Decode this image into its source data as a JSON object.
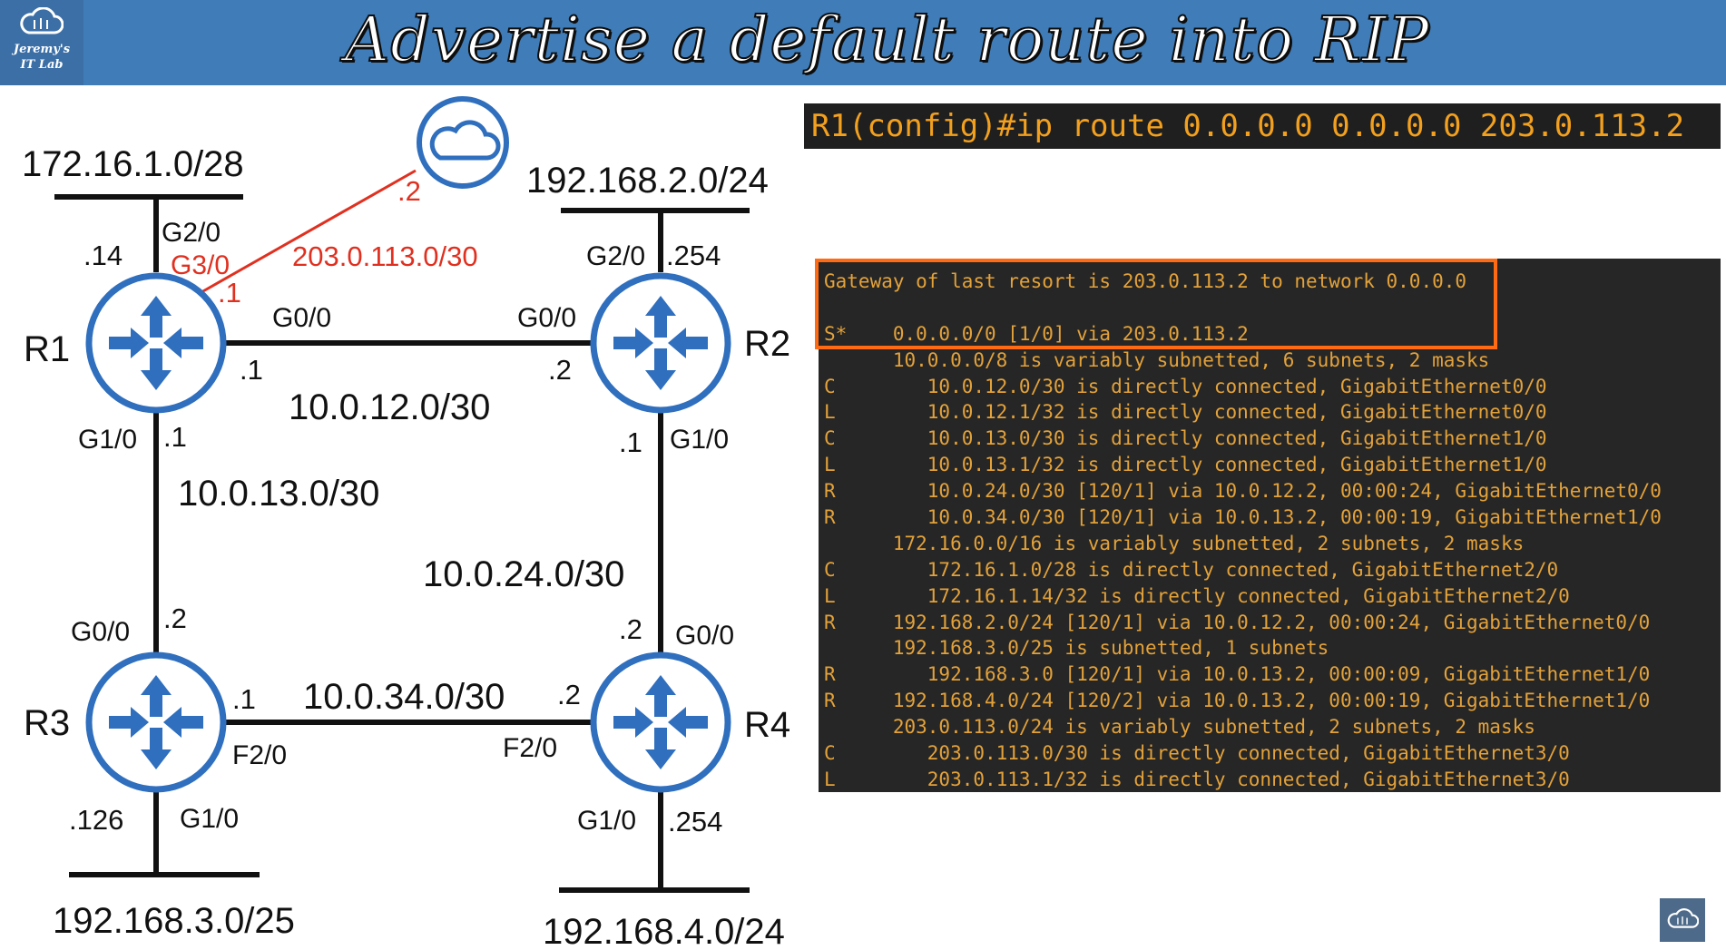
{
  "header": {
    "title": "Advertise a default route into RIP",
    "logo_line1": "Jeremy's",
    "logo_line2": "IT Lab"
  },
  "colors": {
    "header_bg": "#3f7cb8",
    "router_blue": "#2f6fbe",
    "link_red": "#e03020",
    "terminal_text": "#e3a23a",
    "highlight": "#ff6a13"
  },
  "diagram": {
    "routers": [
      {
        "id": "R1",
        "label": "R1"
      },
      {
        "id": "R2",
        "label": "R2"
      },
      {
        "id": "R3",
        "label": "R3"
      },
      {
        "id": "R4",
        "label": "R4"
      }
    ],
    "cloud": {
      "icon": "cloud-icon",
      "ip": ".2"
    },
    "lan_networks": {
      "r1": "172.16.1.0/28",
      "r2": "192.168.2.0/24",
      "r3": "192.168.3.0/25",
      "r4": "192.168.4.0/24"
    },
    "links": {
      "r1_r2": "10.0.12.0/30",
      "r1_r3": "10.0.13.0/30",
      "r2_r4": "10.0.24.0/30",
      "r3_r4": "10.0.34.0/30",
      "r1_internet": "203.0.113.0/30"
    },
    "interfaces": {
      "r1_g20": "G2/0",
      "r1_g20_ip": ".14",
      "r1_g30": "G3/0",
      "r1_g30_ip": ".1",
      "r1_g00": "G0/0",
      "r1_g00_ip": ".1",
      "r1_g10": "G1/0",
      "r1_g10_ip": ".1",
      "r2_g20": "G2/0",
      "r2_g20_ip": ".254",
      "r2_g00": "G0/0",
      "r2_g00_ip": ".2",
      "r2_g10": "G1/0",
      "r2_g10_ip": ".1",
      "r3_g00": "G0/0",
      "r3_g00_ip": ".2",
      "r3_f20": "F2/0",
      "r3_f20_ip": ".1",
      "r3_g10": "G1/0",
      "r3_g10_ip": ".126",
      "r4_g00": "G0/0",
      "r4_g00_ip": ".2",
      "r4_f20": "F2/0",
      "r4_f20_ip": ".2",
      "r4_g10": "G1/0",
      "r4_g10_ip": ".254"
    }
  },
  "command": "R1(config)#ip route 0.0.0.0 0.0.0.0 203.0.113.2",
  "routing_table": [
    "Gateway of last resort is 203.0.113.2 to network 0.0.0.0",
    "",
    "S*    0.0.0.0/0 [1/0] via 203.0.113.2",
    "      10.0.0.0/8 is variably subnetted, 6 subnets, 2 masks",
    "C        10.0.12.0/30 is directly connected, GigabitEthernet0/0",
    "L        10.0.12.1/32 is directly connected, GigabitEthernet0/0",
    "C        10.0.13.0/30 is directly connected, GigabitEthernet1/0",
    "L        10.0.13.1/32 is directly connected, GigabitEthernet1/0",
    "R        10.0.24.0/30 [120/1] via 10.0.12.2, 00:00:24, GigabitEthernet0/0",
    "R        10.0.34.0/30 [120/1] via 10.0.13.2, 00:00:19, GigabitEthernet1/0",
    "      172.16.0.0/16 is variably subnetted, 2 subnets, 2 masks",
    "C        172.16.1.0/28 is directly connected, GigabitEthernet2/0",
    "L        172.16.1.14/32 is directly connected, GigabitEthernet2/0",
    "R     192.168.2.0/24 [120/1] via 10.0.12.2, 00:00:24, GigabitEthernet0/0",
    "      192.168.3.0/25 is subnetted, 1 subnets",
    "R        192.168.3.0 [120/1] via 10.0.13.2, 00:00:09, GigabitEthernet1/0",
    "R     192.168.4.0/24 [120/2] via 10.0.13.2, 00:00:19, GigabitEthernet1/0",
    "      203.0.113.0/24 is variably subnetted, 2 subnets, 2 masks",
    "C        203.0.113.0/30 is directly connected, GigabitEthernet3/0",
    "L        203.0.113.1/32 is directly connected, GigabitEthernet3/0"
  ]
}
